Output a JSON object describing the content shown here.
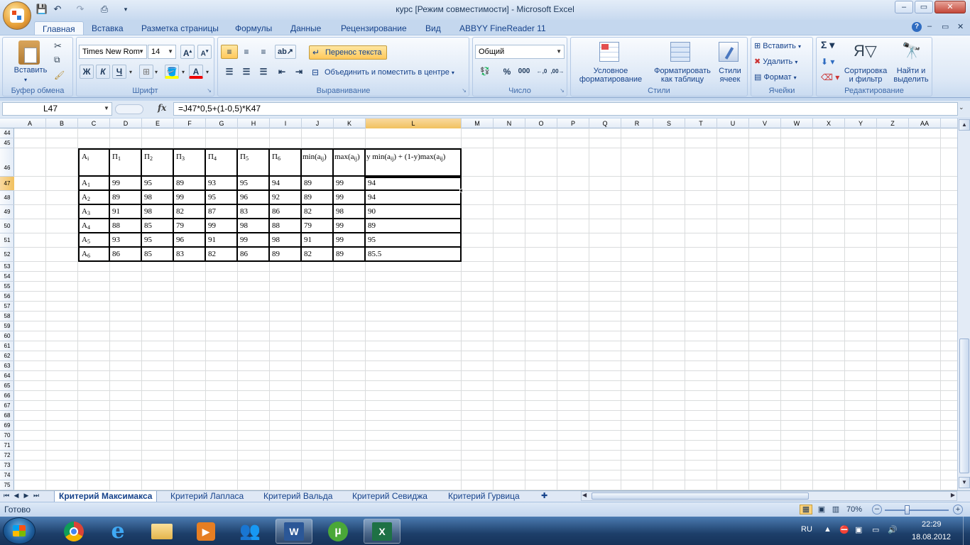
{
  "window": {
    "title": "курс  [Режим совместимости] - Microsoft Excel",
    "min": "–",
    "max": "▭",
    "close": "✕"
  },
  "ribbon_tabs": [
    "Главная",
    "Вставка",
    "Разметка страницы",
    "Формулы",
    "Данные",
    "Рецензирование",
    "Вид",
    "ABBYY FineReader 11"
  ],
  "groups": {
    "clipboard": {
      "label": "Буфер обмена",
      "paste": "Вставить"
    },
    "font": {
      "label": "Шрифт",
      "font_name": "Times New Rom",
      "font_size": "14",
      "bold": "Ж",
      "italic": "К",
      "underline": "Ч"
    },
    "alignment": {
      "label": "Выравнивание",
      "wrap": "Перенос текста",
      "merge": "Объединить и поместить в центре"
    },
    "number": {
      "label": "Число",
      "format": "Общий",
      "percent": "%",
      "thousands": "000"
    },
    "styles": {
      "label": "Стили",
      "conditional": "Условное форматирование",
      "as_table": "Форматировать как таблицу",
      "cell_styles": "Стили ячеек"
    },
    "cells": {
      "label": "Ячейки",
      "insert": "Вставить",
      "delete": "Удалить",
      "format": "Формат"
    },
    "editing": {
      "label": "Редактирование",
      "sort": "Сортировка и фильтр",
      "find": "Найти и выделить"
    }
  },
  "formula_bar": {
    "name_box": "L47",
    "fx": "fx",
    "formula": "=J47*0,5+(1-0,5)*K47"
  },
  "columns": [
    "A",
    "B",
    "C",
    "D",
    "E",
    "F",
    "G",
    "H",
    "I",
    "J",
    "K",
    "L",
    "M",
    "N",
    "O",
    "P",
    "Q",
    "R",
    "S",
    "T",
    "U",
    "V",
    "W",
    "X",
    "Y",
    "Z",
    "AA"
  ],
  "rows": [
    "44",
    "45",
    "46",
    "47",
    "48",
    "49",
    "50",
    "51",
    "52",
    "53",
    "54",
    "55",
    "56",
    "57",
    "58",
    "59",
    "60",
    "61",
    "62",
    "63",
    "64",
    "65",
    "66",
    "67",
    "68",
    "69",
    "70",
    "71",
    "72",
    "73",
    "74",
    "75"
  ],
  "table": {
    "headers": {
      "a": "A",
      "a_sub": "i",
      "p": "П",
      "p_subs": [
        "1",
        "2",
        "3",
        "4",
        "5",
        "6"
      ],
      "min": "min(a",
      "min_sub": "ij",
      "close": ")",
      "max": "max(a",
      "max_sub": "ij",
      "formula_a": "y min(a",
      "formula_b": ") + (1-y)max(a"
    },
    "row_labels": [
      "1",
      "2",
      "3",
      "4",
      "5",
      "6"
    ],
    "data": [
      [
        "99",
        "95",
        "89",
        "93",
        "95",
        "94",
        "89",
        "99",
        "94"
      ],
      [
        "89",
        "98",
        "99",
        "95",
        "96",
        "92",
        "89",
        "99",
        "94"
      ],
      [
        "91",
        "98",
        "82",
        "87",
        "83",
        "86",
        "82",
        "98",
        "90"
      ],
      [
        "88",
        "85",
        "79",
        "99",
        "98",
        "88",
        "79",
        "99",
        "89"
      ],
      [
        "93",
        "95",
        "96",
        "91",
        "99",
        "98",
        "91",
        "99",
        "95"
      ],
      [
        "86",
        "85",
        "83",
        "82",
        "86",
        "89",
        "82",
        "89",
        "85.5"
      ]
    ]
  },
  "sheets": [
    "Критерий Максимакса",
    "Критерий Лапласа",
    "Критерий Вальда",
    "Критерий Севиджа",
    "Критерий Гурвица"
  ],
  "status": {
    "ready": "Готово",
    "zoom": "70%"
  },
  "tray": {
    "lang": "RU",
    "time": "22:29",
    "date": "18.08.2012"
  }
}
